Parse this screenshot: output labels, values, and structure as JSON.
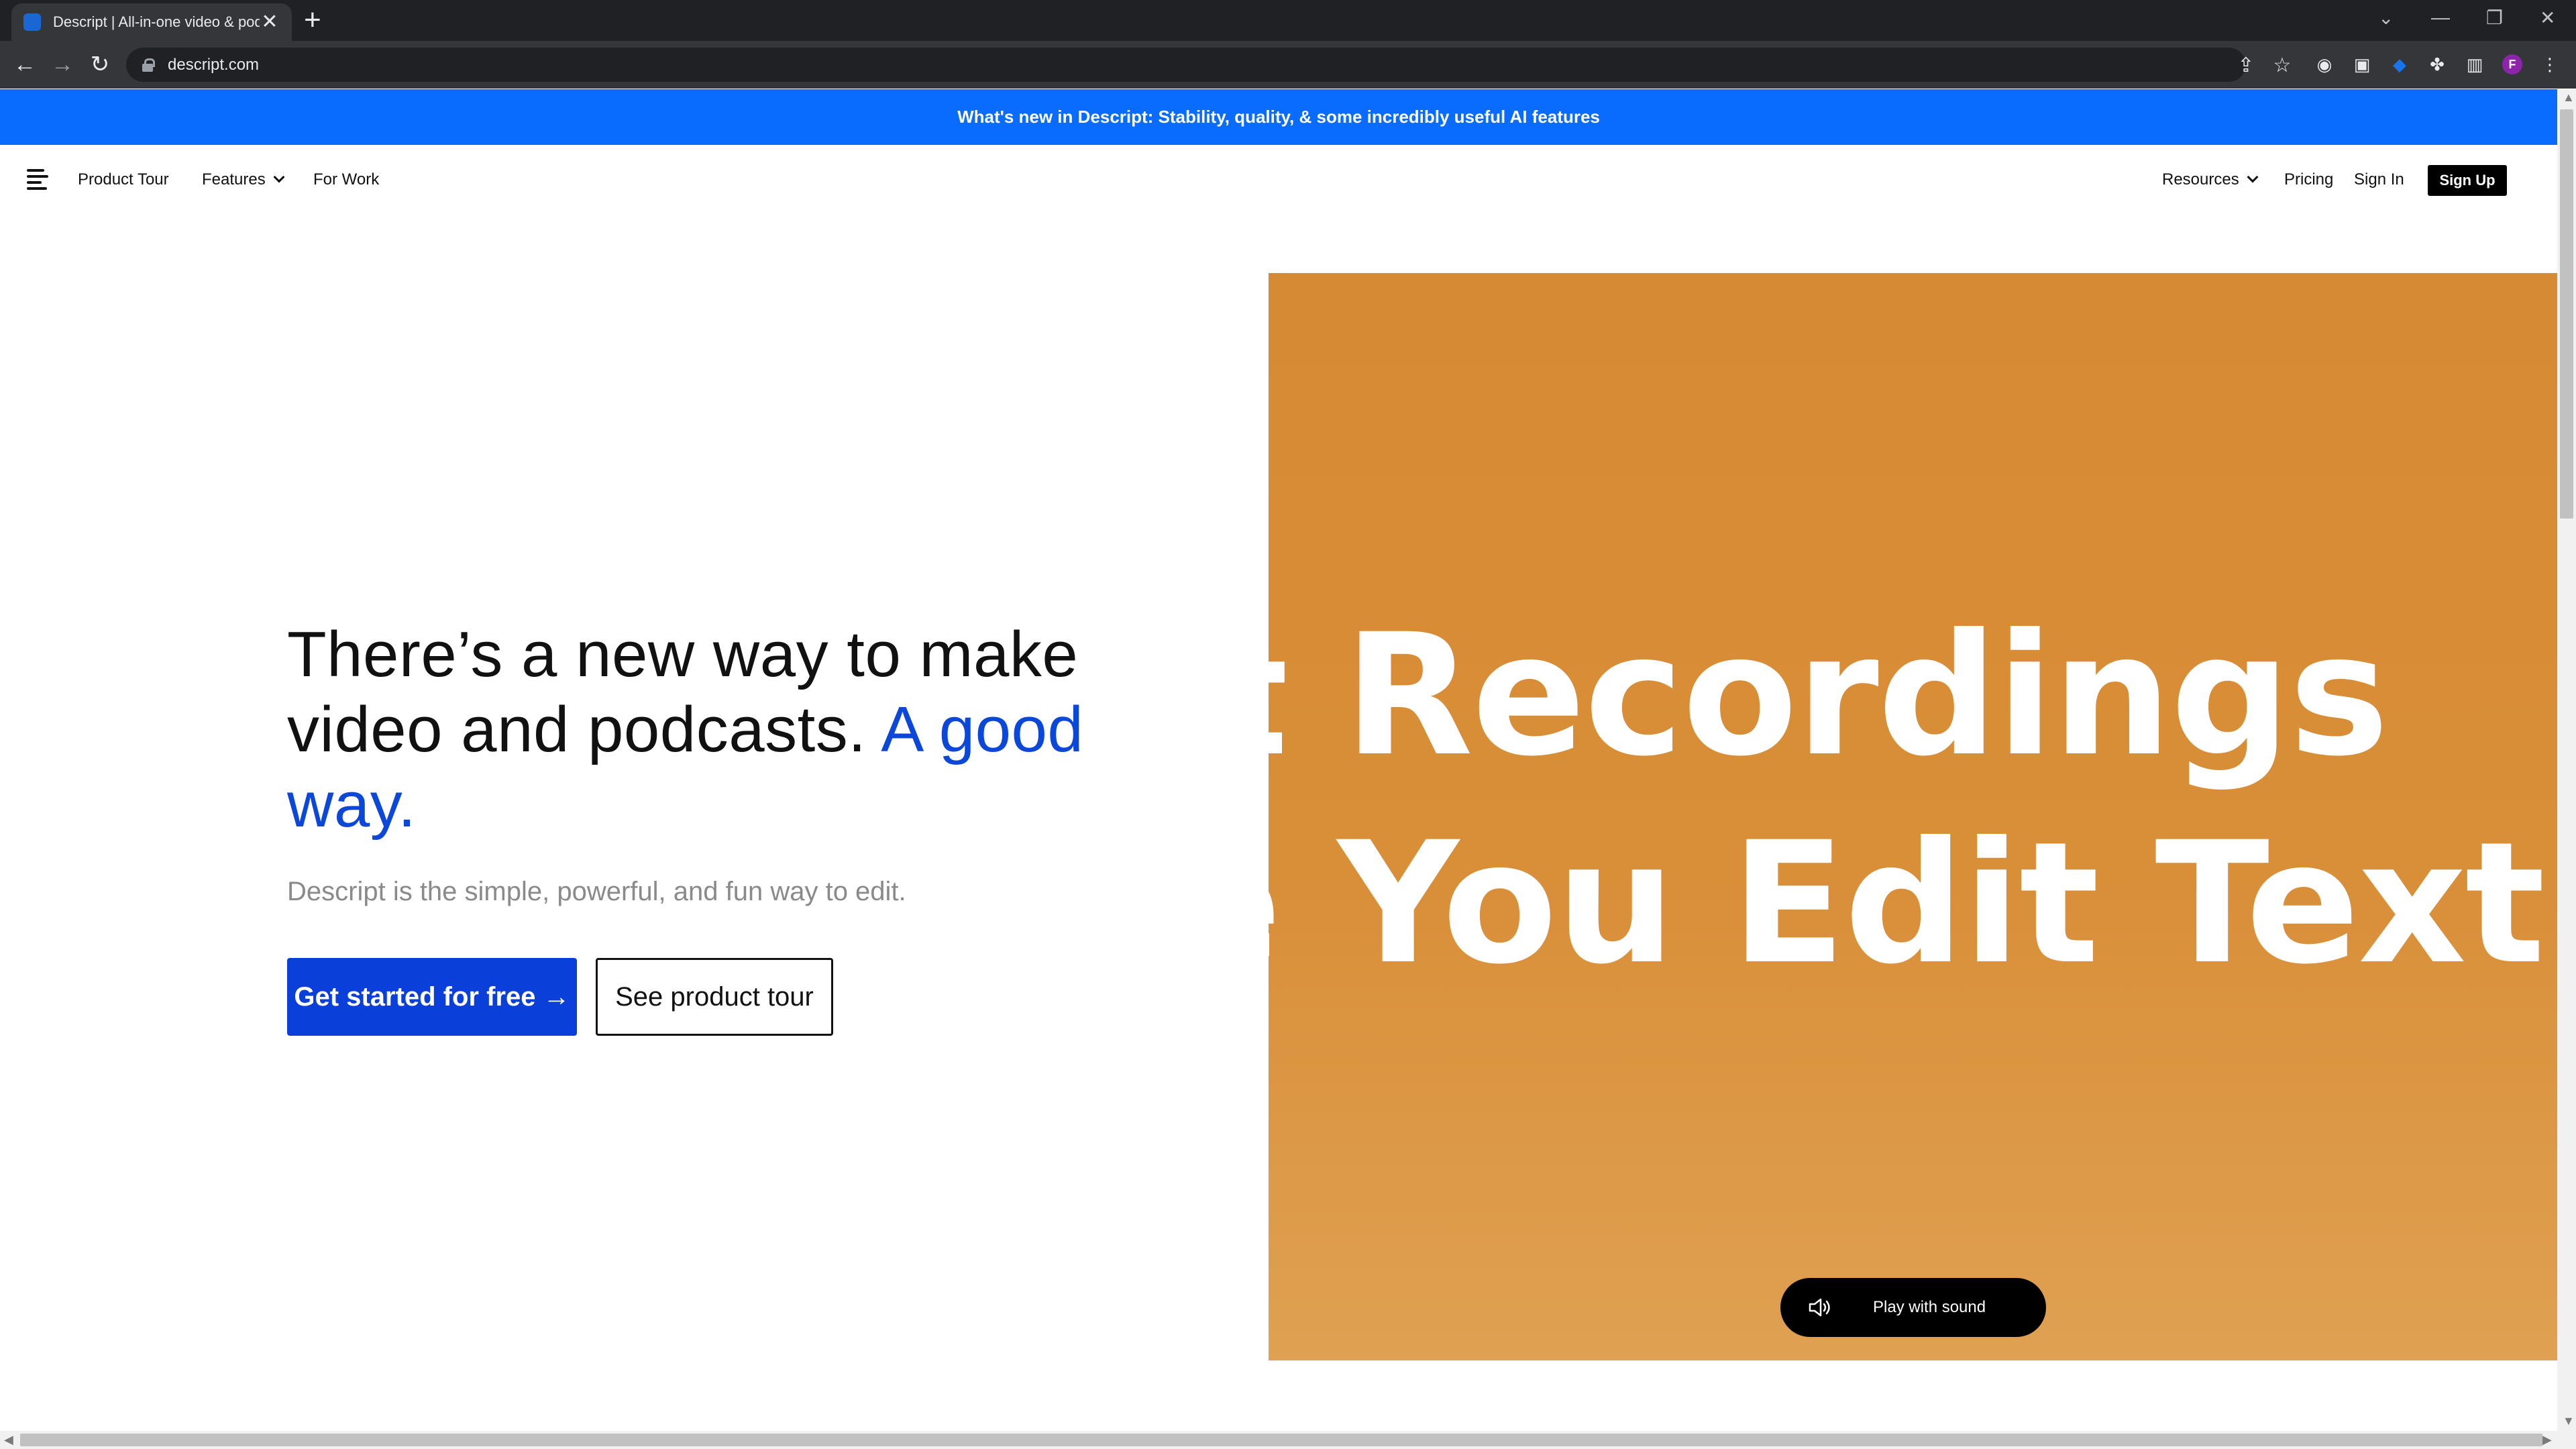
{
  "browser": {
    "tab_title": "Descript | All-in-one video & podcast editing",
    "tab_close": "✕",
    "new_tab": "+",
    "url": "descript.com",
    "profile_initial": "F"
  },
  "announcement": "What's new in Descript: Stability, quality, & some incredibly useful AI features",
  "nav": {
    "product_tour": "Product Tour",
    "features": "Features",
    "for_work": "For Work",
    "resources": "Resources",
    "pricing": "Pricing",
    "sign_in": "Sign In",
    "sign_up": "Sign Up"
  },
  "hero": {
    "headline_part1": "There’s a new way to make video and podcasts.",
    "headline_accent": "A good way.",
    "subtext": "Descript is the simple, powerful, and fun way to edit.",
    "cta_primary": "Get started for free →",
    "cta_secondary": "See product tour",
    "video_line1": "t Recordings",
    "video_line2": "e You Edit Text",
    "play_sound": "Play with sound"
  },
  "colors": {
    "announce_bg": "#0a6cff",
    "accent_text": "#0b47d8",
    "primary_button": "#0b3fd9",
    "hero_bg": "#d68a33"
  }
}
